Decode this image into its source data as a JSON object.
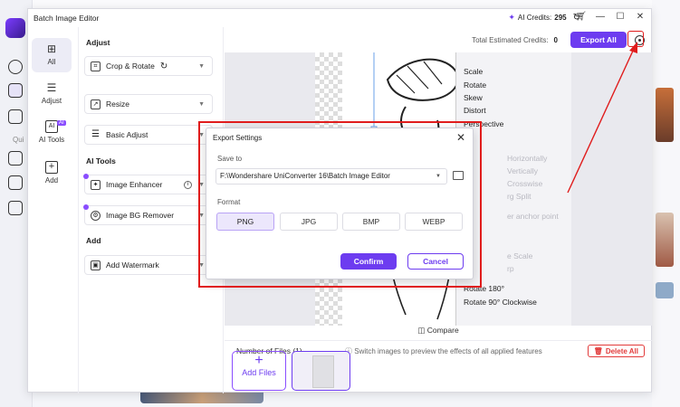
{
  "window": {
    "title": "Batch Image Editor",
    "ai_credits_label": "AI Credits:",
    "ai_credits_value": "295"
  },
  "background": {
    "quick_label": "Qui"
  },
  "nav": {
    "items": [
      {
        "label": "All"
      },
      {
        "label": "Adjust"
      },
      {
        "label": "AI Tools",
        "badge": "AI"
      },
      {
        "label": "Add"
      }
    ]
  },
  "tools": {
    "sections": {
      "adjust": "Adjust",
      "ai_tools": "AI Tools",
      "add": "Add"
    },
    "items": {
      "crop_rotate": "Crop & Rotate",
      "resize": "Resize",
      "basic_adjust": "Basic Adjust",
      "image_enhancer": "Image Enhancer",
      "image_bg_remover": "Image BG Remover",
      "add_watermark": "Add Watermark"
    }
  },
  "workspace": {
    "estimated_label": "Total Estimated Credits:",
    "estimated_value": "0",
    "export_all": "Export All",
    "compare": "Compare",
    "number_of_files": "Number of Files (1)",
    "hint": "Switch images to preview the effects of all applied features",
    "delete_all": "Delete All",
    "add_files": "Add Files"
  },
  "context_menu": {
    "items": [
      {
        "label": "Scale",
        "enabled": true
      },
      {
        "label": "Rotate",
        "enabled": true
      },
      {
        "label": "Skew",
        "enabled": true
      },
      {
        "label": "Distort",
        "enabled": true
      },
      {
        "label": "Perspective",
        "enabled": true
      },
      {
        "label": "Horizontally",
        "enabled": false
      },
      {
        "label": "Vertically",
        "enabled": false
      },
      {
        "label": "Crosswise",
        "enabled": false
      },
      {
        "label": "rg Split",
        "enabled": false
      },
      {
        "label": "er anchor point",
        "enabled": false
      },
      {
        "label": "e Scale",
        "enabled": false
      },
      {
        "label": "rp",
        "enabled": false
      },
      {
        "label": "Rotate 180°",
        "enabled": true
      },
      {
        "label": "Rotate 90° Clockwise",
        "enabled": true
      }
    ]
  },
  "dialog": {
    "title": "Export Settings",
    "save_to_label": "Save to",
    "save_path": "F:\\Wondershare UniConverter 16\\Batch Image Editor",
    "format_label": "Format",
    "formats": [
      "PNG",
      "JPG",
      "BMP",
      "WEBP"
    ],
    "selected_format": "PNG",
    "confirm": "Confirm",
    "cancel": "Cancel"
  },
  "colors": {
    "accent": "#6d3cf0",
    "annotation": "#e01c1c",
    "delete": "#e23b3b"
  }
}
